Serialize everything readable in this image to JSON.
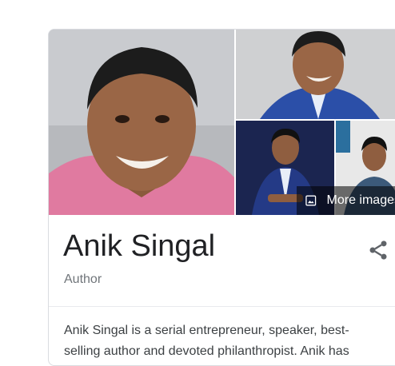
{
  "knowledge_panel": {
    "more_images_label": "More images",
    "name": "Anik Singal",
    "subtitle": "Author",
    "description": "Anik Singal is a serial entrepreneur, speaker, best-selling author and devoted philanthropist. Anik has"
  },
  "icons": {
    "more_images": "image-icon",
    "share": "share-icon"
  }
}
